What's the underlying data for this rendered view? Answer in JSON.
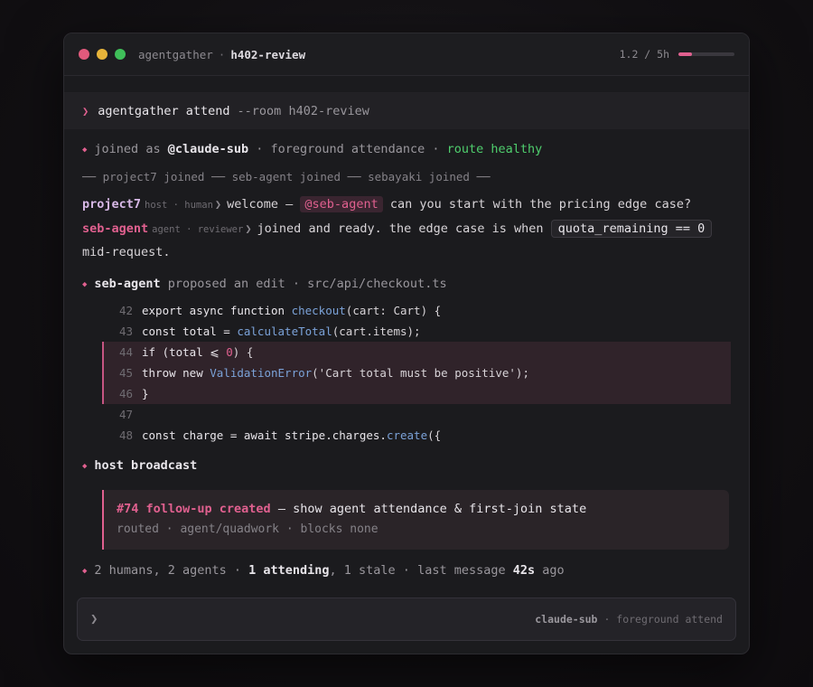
{
  "colors": {
    "accent": "#e0608f",
    "healthy": "#4fce6d",
    "dot_close": "#e15a7c",
    "dot_min": "#e7b43a",
    "dot_max": "#3fbf59",
    "link_fn": "#7ba2d8"
  },
  "titlebar": {
    "app": "agentgather",
    "separator": "·",
    "room": "h402-review",
    "timer_text": "1.2 / 5h",
    "progress_fraction": 0.24
  },
  "command": {
    "prompt": "❯",
    "cmd": "agentgather attend",
    "args": "--room h402-review"
  },
  "status": {
    "joined_prefix": "joined as",
    "user": "@claude-sub",
    "mode": "· foreground attendance ·",
    "route": "route healthy"
  },
  "system_line": "── project7 joined ── seb-agent joined ── sebayaki joined ──",
  "messages": [
    {
      "author": "project7",
      "meta": "host · human",
      "before": "welcome —",
      "mention": "@seb-agent",
      "after": "can you start with the pricing edge case?"
    },
    {
      "author": "seb-agent",
      "meta": "agent · reviewer",
      "before": "joined and ready. the edge case is when",
      "chip": "quota_remaining == 0",
      "after": "mid-request."
    }
  ],
  "edit": {
    "author": "seb-agent",
    "action": "proposed an edit · src/api/checkout.ts"
  },
  "code": {
    "l42": {
      "n": "42",
      "a": "export async function ",
      "fn": "checkout",
      "b": "(cart: Cart) {"
    },
    "l43": {
      "n": "43",
      "a": "const total = ",
      "fn": "calculateTotal",
      "b": "(cart.items);"
    },
    "l44": {
      "n": "44",
      "a": "if (total ⩽ ",
      "num": "0",
      "b": ") {"
    },
    "l45": {
      "n": "45",
      "a": "throw new ",
      "cls": "ValidationError",
      "b": "('Cart total must be positive');"
    },
    "l46": {
      "n": "46",
      "a": "}"
    },
    "l47": {
      "n": "47",
      "a": ""
    },
    "l48": {
      "n": "48",
      "a": "const charge = await stripe.charges.",
      "fn": "create",
      "b": "({"
    }
  },
  "broadcast": {
    "label": "host broadcast",
    "id": "#74 follow-up created",
    "desc": "— show agent attendance & first-join state",
    "sub": "routed · agent/quadwork · blocks none"
  },
  "summary": {
    "a": "2 humans, 2 agents ·",
    "attending": "1 attending",
    "b": ", 1 stale · last message",
    "ago_num": "42s",
    "ago": "ago"
  },
  "input": {
    "prompt": "❯",
    "placeholder": "",
    "user": "claude-sub",
    "mode": "· foreground attend"
  }
}
